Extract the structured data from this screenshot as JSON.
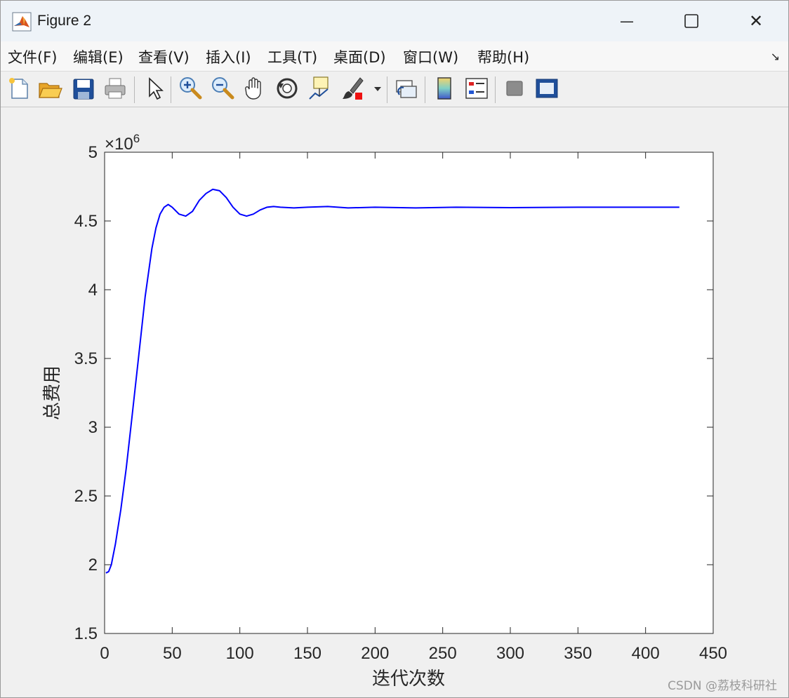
{
  "window": {
    "title": "Figure 2",
    "minimize_glyph": "—",
    "close_glyph": "✕"
  },
  "menu": {
    "items": [
      {
        "label": "文件(F)"
      },
      {
        "label": "编辑(E)"
      },
      {
        "label": "查看(V)"
      },
      {
        "label": "插入(I)"
      },
      {
        "label": "工具(T)"
      },
      {
        "label": "桌面(D)"
      },
      {
        "label": "窗口(W)"
      },
      {
        "label": "帮助(H)"
      }
    ],
    "dock_glyph": "↘"
  },
  "toolbar": {
    "icons": [
      "new-figure-icon",
      "open-file-icon",
      "save-icon",
      "print-icon",
      "select-arrow-icon",
      "zoom-in-icon",
      "zoom-out-icon",
      "pan-hand-icon",
      "rotate-3d-icon",
      "data-cursor-icon",
      "brush-icon",
      "brush-dropdown-icon",
      "link-plot-icon",
      "colorbar-icon",
      "legend-icon",
      "hide-plot-tools-icon",
      "show-plot-tools-icon"
    ]
  },
  "chart_data": {
    "type": "line",
    "title": "",
    "xlabel": "迭代次数",
    "ylabel": "总费用",
    "xlim": [
      0,
      450
    ],
    "ylim": [
      1.5,
      5
    ],
    "y_scale_exponent_label": "×10",
    "y_scale_exponent": "6",
    "x_ticks": [
      "0",
      "50",
      "100",
      "150",
      "200",
      "250",
      "300",
      "350",
      "400",
      "450"
    ],
    "y_ticks": [
      "1.5",
      "2",
      "2.5",
      "3",
      "3.5",
      "4",
      "4.5",
      "5"
    ],
    "grid": false,
    "line_color": "#0000ff",
    "series": [
      {
        "x": [
          1,
          3,
          5,
          8,
          12,
          16,
          20,
          25,
          30,
          35,
          38,
          41,
          44,
          47,
          50,
          55,
          60,
          65,
          70,
          75,
          80,
          85,
          90,
          95,
          100,
          105,
          110,
          115,
          120,
          125,
          130,
          140,
          150,
          165,
          180,
          200,
          230,
          260,
          300,
          350,
          400,
          425
        ],
        "y": [
          1.94,
          1.95,
          2.0,
          2.15,
          2.4,
          2.7,
          3.05,
          3.5,
          3.95,
          4.3,
          4.45,
          4.55,
          4.6,
          4.62,
          4.6,
          4.55,
          4.535,
          4.57,
          4.65,
          4.7,
          4.73,
          4.72,
          4.67,
          4.6,
          4.55,
          4.535,
          4.55,
          4.58,
          4.6,
          4.605,
          4.6,
          4.595,
          4.6,
          4.605,
          4.595,
          4.6,
          4.595,
          4.6,
          4.597,
          4.6,
          4.6,
          4.6
        ]
      }
    ]
  },
  "watermark": "CSDN @荔枝科研社"
}
